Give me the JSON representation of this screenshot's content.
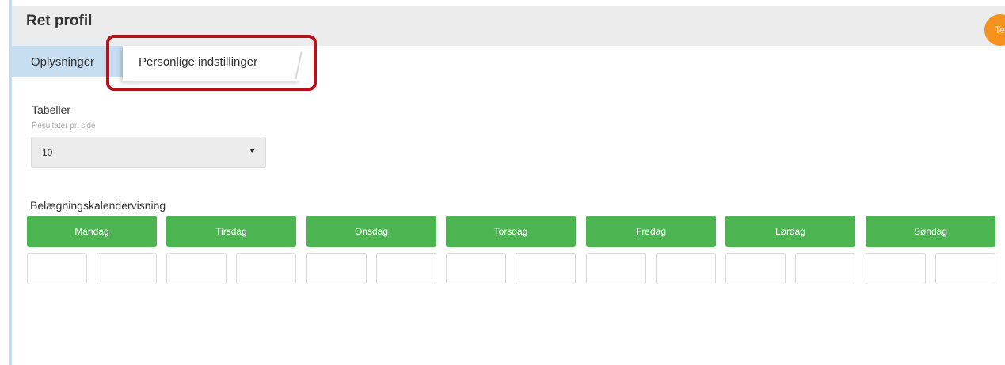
{
  "header": {
    "title": "Ret profil",
    "avatar_initials": "Te",
    "avatar_color": "#f5921e"
  },
  "tabs": [
    {
      "label": "Oplysninger",
      "active": false
    },
    {
      "label": "Personlige indstillinger",
      "active": true
    }
  ],
  "highlight_color": "#b3121b",
  "tables": {
    "section_label": "Tabeller",
    "sub_label": "Resultater pr. side",
    "selected_value": "10",
    "caret_icon": "caret-down-icon"
  },
  "calendar": {
    "section_label": "Belægningskalendervisning",
    "button_color": "#4cb552",
    "days": [
      {
        "label": "Mandag",
        "from": "",
        "to": ""
      },
      {
        "label": "Tirsdag",
        "from": "",
        "to": ""
      },
      {
        "label": "Onsdag",
        "from": "",
        "to": ""
      },
      {
        "label": "Torsdag",
        "from": "",
        "to": ""
      },
      {
        "label": "Fredag",
        "from": "",
        "to": ""
      },
      {
        "label": "Lørdag",
        "from": "",
        "to": ""
      },
      {
        "label": "Søndag",
        "from": "",
        "to": ""
      }
    ]
  }
}
